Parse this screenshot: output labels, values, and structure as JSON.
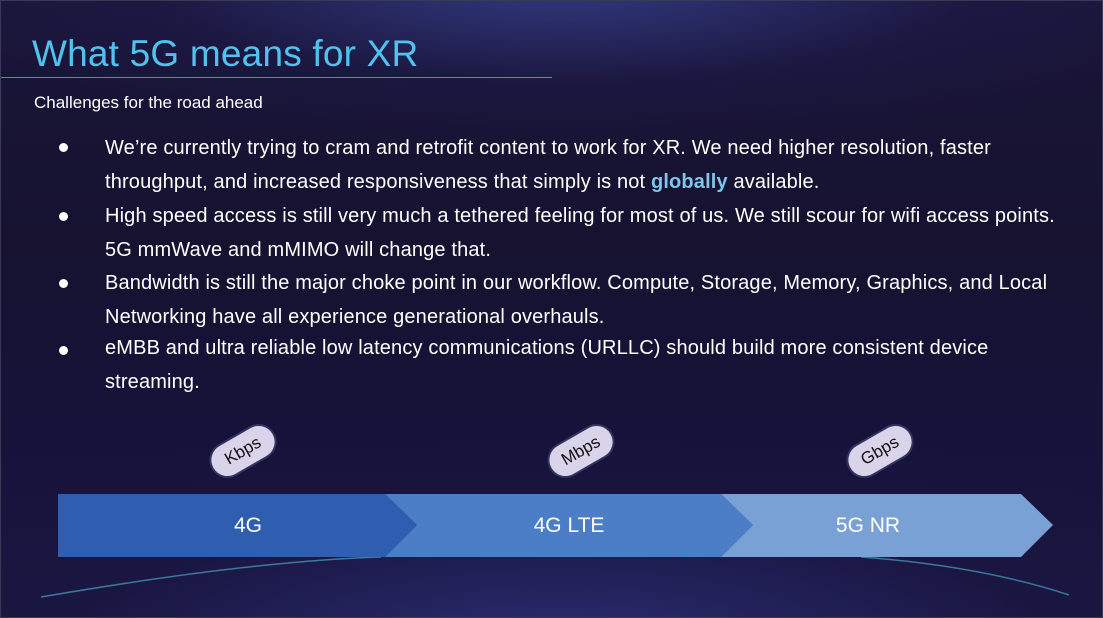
{
  "slide": {
    "title": "What 5G means for XR",
    "subtitle": "Challenges for the road ahead",
    "bullets": [
      {
        "before": "We’re currently trying to cram and retrofit content to work for XR. We need higher resolution, faster throughput, and increased responsiveness that simply is not ",
        "highlight": "globally",
        "after": " available."
      },
      {
        "before": "High speed access is still very much a tethered feeling for most of us. We still scour for wifi access points. 5G mmWave and mMIMO will change that.",
        "highlight": "",
        "after": ""
      },
      {
        "before": "Bandwidth is still the major choke point in our workflow. Compute, Storage, Memory, Graphics, and Local Networking have all experience generational overhauls.",
        "highlight": "",
        "after": ""
      },
      {
        "before": "eMBB and ultra reliable low latency communications (URLLC) should build more consistent device streaming.",
        "highlight": "",
        "after": ""
      }
    ],
    "speed_labels": [
      "Kbps",
      "Mbps",
      "Gbps"
    ],
    "segments": [
      "4G",
      "4G LTE",
      "5G NR"
    ],
    "colors": {
      "title": "#4fc3ee",
      "highlight": "#7fc6ea",
      "segment_1": "#2f5db0",
      "segment_2": "#4c7ec8",
      "segment_3": "#7aa1d6",
      "pill": "#d9d4ea"
    }
  }
}
